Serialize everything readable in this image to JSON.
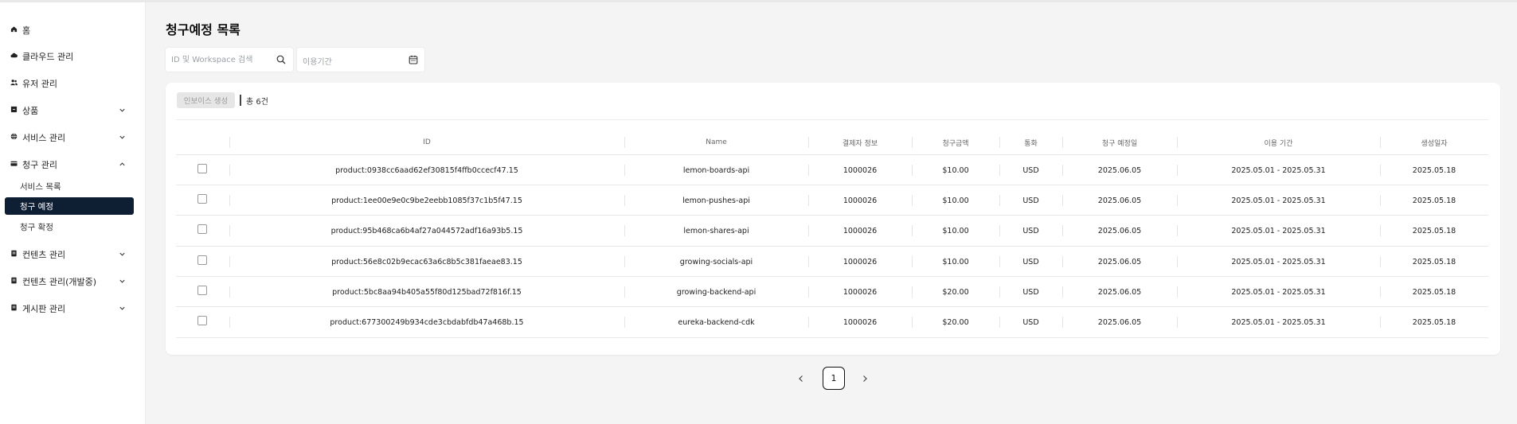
{
  "sidebar": {
    "items": [
      {
        "label": "홈",
        "icon": "home-icon"
      },
      {
        "label": "클라우드 관리",
        "icon": "cloud-icon"
      },
      {
        "label": "유저 관리",
        "icon": "users-icon"
      },
      {
        "label": "상품",
        "icon": "box-icon",
        "chevron": "chevron-down-icon"
      },
      {
        "label": "서비스 관리",
        "icon": "globe-icon",
        "chevron": "chevron-down-icon"
      },
      {
        "label": "청구 관리",
        "icon": "card-icon",
        "chevron": "chevron-up-icon",
        "sub_items": [
          {
            "label": "서비스 목록"
          },
          {
            "label": "청구 예정",
            "active": true
          },
          {
            "label": "청구 확정"
          }
        ]
      },
      {
        "label": "컨텐츠 관리",
        "icon": "document-icon",
        "chevron": "chevron-down-icon"
      },
      {
        "label": "컨텐츠 관리(개발중)",
        "icon": "document-icon",
        "chevron": "chevron-down-icon"
      },
      {
        "label": "게시판 관리",
        "icon": "document-icon",
        "chevron": "chevron-down-icon"
      }
    ]
  },
  "page": {
    "title": "청구예정 목록"
  },
  "filters": {
    "search_placeholder": "ID 및 Workspace 검색",
    "date_placeholder": "이용기간"
  },
  "toolbar": {
    "invoice_button": "인보이스 생성",
    "total": "총 6건"
  },
  "table": {
    "columns": [
      "ID",
      "Name",
      "결제자 정보",
      "청구금액",
      "통화",
      "청구 예정일",
      "이용 기간",
      "생성일자"
    ],
    "rows": [
      [
        "product:0938cc6aad62ef30815f4ffb0ccecf47.15",
        "lemon-boards-api",
        "1000026",
        "$10.00",
        "USD",
        "2025.06.05",
        "2025.05.01 - 2025.05.31",
        "2025.05.18"
      ],
      [
        "product:1ee00e9e0c9be2eebb1085f37c1b5f47.15",
        "lemon-pushes-api",
        "1000026",
        "$10.00",
        "USD",
        "2025.06.05",
        "2025.05.01 - 2025.05.31",
        "2025.05.18"
      ],
      [
        "product:95b468ca6b4af27a044572adf16a93b5.15",
        "lemon-shares-api",
        "1000026",
        "$10.00",
        "USD",
        "2025.06.05",
        "2025.05.01 - 2025.05.31",
        "2025.05.18"
      ],
      [
        "product:56e8c02b9ecac63a6c8b5c381faeae83.15",
        "growing-socials-api",
        "1000026",
        "$10.00",
        "USD",
        "2025.06.05",
        "2025.05.01 - 2025.05.31",
        "2025.05.18"
      ],
      [
        "product:5bc8aa94b405a55f80d125bad72f816f.15",
        "growing-backend-api",
        "1000026",
        "$20.00",
        "USD",
        "2025.06.05",
        "2025.05.01 - 2025.05.31",
        "2025.05.18"
      ],
      [
        "product:677300249b934cde3cbdabfdb47a468b.15",
        "eureka-backend-cdk",
        "1000026",
        "$20.00",
        "USD",
        "2025.06.05",
        "2025.05.01 - 2025.05.31",
        "2025.05.18"
      ]
    ]
  },
  "pagination": {
    "current_page": "1",
    "prev_icon": "chevron-left-icon",
    "next_icon": "chevron-right-icon"
  },
  "colors": {
    "active_nav_bg": "#0f1f33",
    "page_bg": "#f4f4f4",
    "card_bg": "#ffffff"
  }
}
